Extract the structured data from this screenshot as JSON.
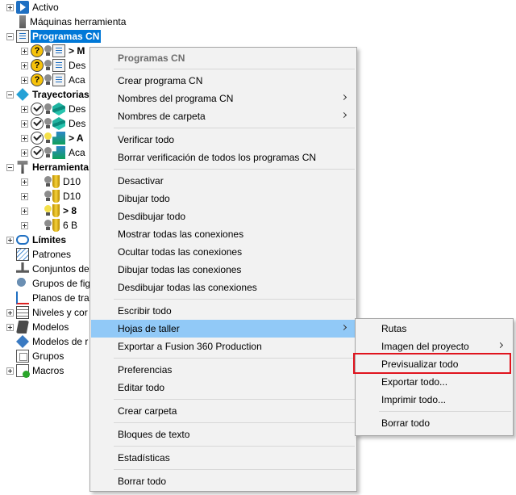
{
  "tree": {
    "activo": "Activo",
    "maquinas": "Máquinas herramienta",
    "programas": "Programas CN",
    "prog_children": [
      "> M",
      "Des",
      "Aca"
    ],
    "trayectorias": "Trayectorias",
    "tray_children": [
      "Des",
      "Des",
      "> A",
      "Aca"
    ],
    "herramientas": "Herramienta",
    "herr_children": [
      "D10",
      "D10",
      "> 8",
      "6 B"
    ],
    "limites": "Límites",
    "patrones": "Patrones",
    "conjuntos": "Conjuntos de",
    "grupos_fig": "Grupos de fig",
    "planos": "Planos de tra",
    "niveles": "Niveles y cor",
    "modelos": "Modelos",
    "modelos2": "Modelos de r",
    "grupos": "Grupos",
    "macros": "Macros"
  },
  "context_menu": {
    "header": "Programas CN",
    "items": [
      "Crear programa CN",
      "Nombres del programa CN",
      "Nombres de carpeta",
      "Verificar todo",
      "Borrar verificación de todos los programas CN",
      "Desactivar",
      "Dibujar todo",
      "Desdibujar todo",
      "Mostrar todas las conexiones",
      "Ocultar todas las conexiones",
      "Dibujar todas las conexiones",
      "Desdibujar todas las conexiones",
      "Escribir todo",
      "Hojas de taller",
      "Exportar a Fusion 360 Production",
      "Preferencias",
      "Editar todo",
      "Crear carpeta",
      "Bloques de texto",
      "Estadísticas",
      "Borrar todo"
    ]
  },
  "submenu": {
    "items": [
      "Rutas",
      "Imagen del proyecto",
      "Previsualizar todo",
      "Exportar todo...",
      "Imprimir todo...",
      "Borrar todo"
    ]
  },
  "colors": {
    "selection": "#0078d7",
    "menu_highlight": "#91c9f7",
    "focus_outline": "#e0141e"
  }
}
